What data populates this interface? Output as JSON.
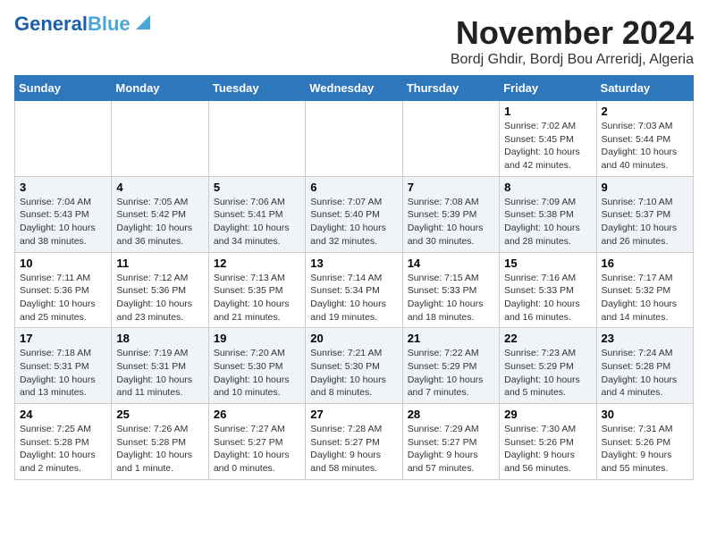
{
  "header": {
    "logo_line1": "General",
    "logo_line2": "Blue",
    "month_title": "November 2024",
    "location": "Bordj Ghdir, Bordj Bou Arreridj, Algeria"
  },
  "weekdays": [
    "Sunday",
    "Monday",
    "Tuesday",
    "Wednesday",
    "Thursday",
    "Friday",
    "Saturday"
  ],
  "weeks": [
    [
      {
        "day": "",
        "info": ""
      },
      {
        "day": "",
        "info": ""
      },
      {
        "day": "",
        "info": ""
      },
      {
        "day": "",
        "info": ""
      },
      {
        "day": "",
        "info": ""
      },
      {
        "day": "1",
        "info": "Sunrise: 7:02 AM\nSunset: 5:45 PM\nDaylight: 10 hours\nand 42 minutes."
      },
      {
        "day": "2",
        "info": "Sunrise: 7:03 AM\nSunset: 5:44 PM\nDaylight: 10 hours\nand 40 minutes."
      }
    ],
    [
      {
        "day": "3",
        "info": "Sunrise: 7:04 AM\nSunset: 5:43 PM\nDaylight: 10 hours\nand 38 minutes."
      },
      {
        "day": "4",
        "info": "Sunrise: 7:05 AM\nSunset: 5:42 PM\nDaylight: 10 hours\nand 36 minutes."
      },
      {
        "day": "5",
        "info": "Sunrise: 7:06 AM\nSunset: 5:41 PM\nDaylight: 10 hours\nand 34 minutes."
      },
      {
        "day": "6",
        "info": "Sunrise: 7:07 AM\nSunset: 5:40 PM\nDaylight: 10 hours\nand 32 minutes."
      },
      {
        "day": "7",
        "info": "Sunrise: 7:08 AM\nSunset: 5:39 PM\nDaylight: 10 hours\nand 30 minutes."
      },
      {
        "day": "8",
        "info": "Sunrise: 7:09 AM\nSunset: 5:38 PM\nDaylight: 10 hours\nand 28 minutes."
      },
      {
        "day": "9",
        "info": "Sunrise: 7:10 AM\nSunset: 5:37 PM\nDaylight: 10 hours\nand 26 minutes."
      }
    ],
    [
      {
        "day": "10",
        "info": "Sunrise: 7:11 AM\nSunset: 5:36 PM\nDaylight: 10 hours\nand 25 minutes."
      },
      {
        "day": "11",
        "info": "Sunrise: 7:12 AM\nSunset: 5:36 PM\nDaylight: 10 hours\nand 23 minutes."
      },
      {
        "day": "12",
        "info": "Sunrise: 7:13 AM\nSunset: 5:35 PM\nDaylight: 10 hours\nand 21 minutes."
      },
      {
        "day": "13",
        "info": "Sunrise: 7:14 AM\nSunset: 5:34 PM\nDaylight: 10 hours\nand 19 minutes."
      },
      {
        "day": "14",
        "info": "Sunrise: 7:15 AM\nSunset: 5:33 PM\nDaylight: 10 hours\nand 18 minutes."
      },
      {
        "day": "15",
        "info": "Sunrise: 7:16 AM\nSunset: 5:33 PM\nDaylight: 10 hours\nand 16 minutes."
      },
      {
        "day": "16",
        "info": "Sunrise: 7:17 AM\nSunset: 5:32 PM\nDaylight: 10 hours\nand 14 minutes."
      }
    ],
    [
      {
        "day": "17",
        "info": "Sunrise: 7:18 AM\nSunset: 5:31 PM\nDaylight: 10 hours\nand 13 minutes."
      },
      {
        "day": "18",
        "info": "Sunrise: 7:19 AM\nSunset: 5:31 PM\nDaylight: 10 hours\nand 11 minutes."
      },
      {
        "day": "19",
        "info": "Sunrise: 7:20 AM\nSunset: 5:30 PM\nDaylight: 10 hours\nand 10 minutes."
      },
      {
        "day": "20",
        "info": "Sunrise: 7:21 AM\nSunset: 5:30 PM\nDaylight: 10 hours\nand 8 minutes."
      },
      {
        "day": "21",
        "info": "Sunrise: 7:22 AM\nSunset: 5:29 PM\nDaylight: 10 hours\nand 7 minutes."
      },
      {
        "day": "22",
        "info": "Sunrise: 7:23 AM\nSunset: 5:29 PM\nDaylight: 10 hours\nand 5 minutes."
      },
      {
        "day": "23",
        "info": "Sunrise: 7:24 AM\nSunset: 5:28 PM\nDaylight: 10 hours\nand 4 minutes."
      }
    ],
    [
      {
        "day": "24",
        "info": "Sunrise: 7:25 AM\nSunset: 5:28 PM\nDaylight: 10 hours\nand 2 minutes."
      },
      {
        "day": "25",
        "info": "Sunrise: 7:26 AM\nSunset: 5:28 PM\nDaylight: 10 hours\nand 1 minute."
      },
      {
        "day": "26",
        "info": "Sunrise: 7:27 AM\nSunset: 5:27 PM\nDaylight: 10 hours\nand 0 minutes."
      },
      {
        "day": "27",
        "info": "Sunrise: 7:28 AM\nSunset: 5:27 PM\nDaylight: 9 hours\nand 58 minutes."
      },
      {
        "day": "28",
        "info": "Sunrise: 7:29 AM\nSunset: 5:27 PM\nDaylight: 9 hours\nand 57 minutes."
      },
      {
        "day": "29",
        "info": "Sunrise: 7:30 AM\nSunset: 5:26 PM\nDaylight: 9 hours\nand 56 minutes."
      },
      {
        "day": "30",
        "info": "Sunrise: 7:31 AM\nSunset: 5:26 PM\nDaylight: 9 hours\nand 55 minutes."
      }
    ]
  ]
}
